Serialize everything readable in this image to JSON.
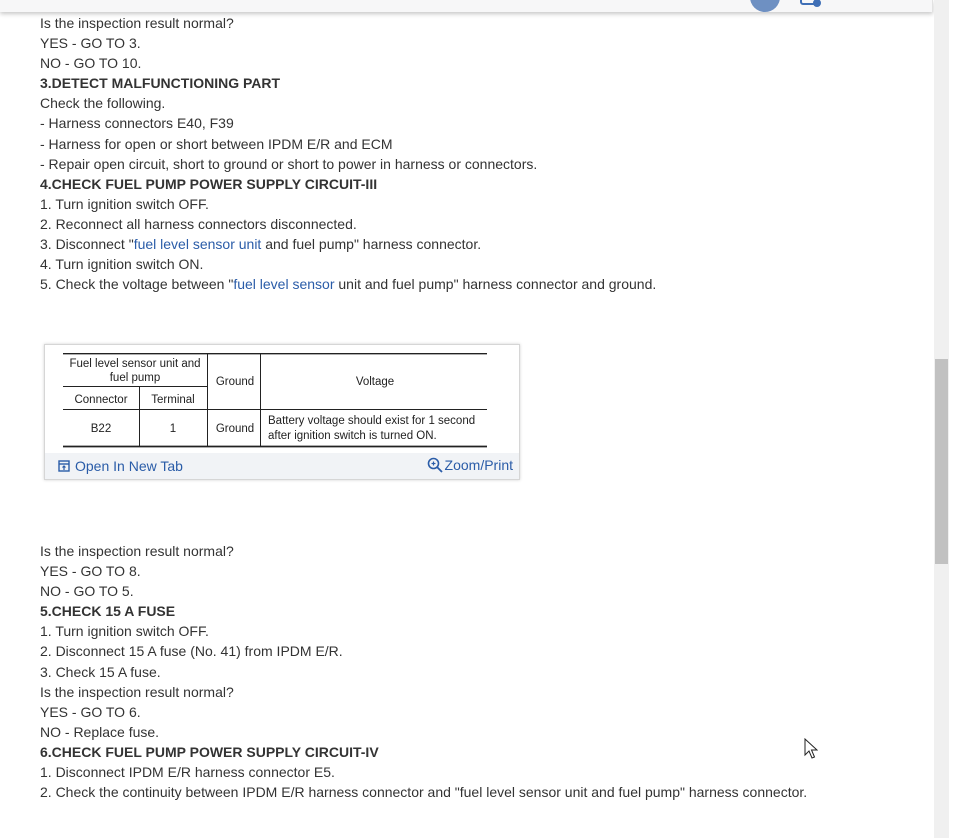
{
  "lines_top": [
    {
      "text": "Is the inspection result normal?",
      "bold": false
    },
    {
      "text": "YES - GO TO 3.",
      "bold": false
    },
    {
      "text": "NO - GO TO 10.",
      "bold": false
    },
    {
      "text": "3.DETECT MALFUNCTIONING PART",
      "bold": true
    },
    {
      "text": "Check the following.",
      "bold": false
    },
    {
      "text": "-  Harness connectors E40, F39",
      "bold": false
    },
    {
      "text": "-  Harness for open or short between IPDM E/R and ECM",
      "bold": false
    },
    {
      "text": "- Repair open circuit, short to ground or short to power in harness or connectors.",
      "bold": false
    },
    {
      "text": "4.CHECK FUEL PUMP POWER SUPPLY CIRCUIT-III",
      "bold": true
    },
    {
      "text": "1. Turn ignition switch OFF.",
      "bold": false
    },
    {
      "text": "2. Reconnect all harness connectors disconnected.",
      "bold": false
    }
  ],
  "step3": {
    "prefix": "3. Disconnect \"",
    "link": "fuel level sensor unit",
    "suffix": " and fuel pump\" harness connector."
  },
  "step4": "4. Turn ignition switch ON.",
  "step5": {
    "prefix": "5. Check the voltage between \"",
    "link": "fuel level sensor",
    "suffix": " unit and fuel pump\" harness connector and ground."
  },
  "table": {
    "group_header_1": "Fuel level sensor unit and",
    "group_header_2": "fuel pump",
    "col_connector": "Connector",
    "col_terminal": "Terminal",
    "col_ground": "Ground",
    "col_voltage": "Voltage",
    "row_connector": "B22",
    "row_terminal": "1",
    "row_ground": "Ground",
    "row_voltage_1": "Battery voltage should exist for 1 second",
    "row_voltage_2": "after ignition switch is turned ON."
  },
  "figbar": {
    "open_label": "Open In New Tab",
    "zoom_label": "Zoom/Print"
  },
  "lines_bottom": [
    {
      "text": "Is the inspection result normal?",
      "bold": false
    },
    {
      "text": "YES - GO TO 8.",
      "bold": false
    },
    {
      "text": "NO - GO TO 5.",
      "bold": false
    },
    {
      "text": "5.CHECK 15 A FUSE",
      "bold": true
    },
    {
      "text": "1. Turn ignition switch OFF.",
      "bold": false
    },
    {
      "text": "2. Disconnect 15 A fuse (No. 41) from IPDM E/R.",
      "bold": false
    },
    {
      "text": "3. Check 15 A fuse.",
      "bold": false
    },
    {
      "text": "Is the inspection result normal?",
      "bold": false
    },
    {
      "text": "YES - GO TO 6.",
      "bold": false
    },
    {
      "text": "NO - Replace fuse.",
      "bold": false
    },
    {
      "text": "6.CHECK FUEL PUMP POWER SUPPLY CIRCUIT-IV",
      "bold": true
    },
    {
      "text": "1. Disconnect IPDM E/R harness connector E5.",
      "bold": false
    },
    {
      "text": "2. Check the continuity between IPDM E/R harness connector and \"fuel level sensor unit and fuel pump\" harness connector.",
      "bold": false
    }
  ],
  "colors": {
    "link": "#2a5ca8",
    "text": "#333333"
  }
}
